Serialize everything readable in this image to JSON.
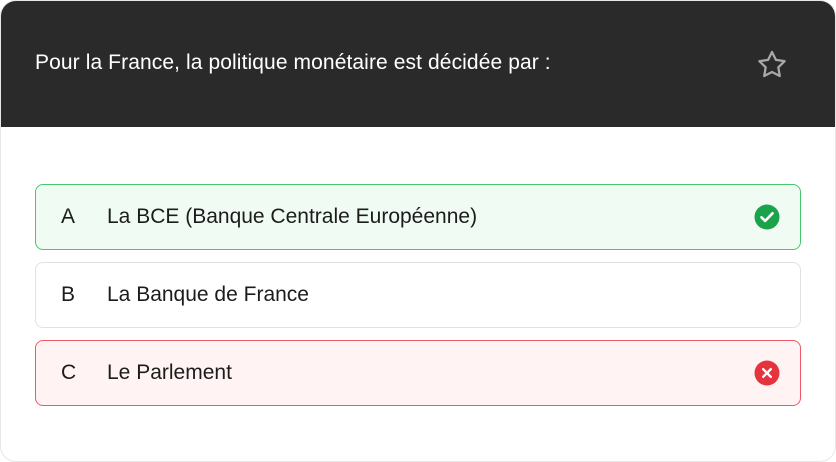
{
  "question": {
    "text": "Pour la France, la politique monétaire est décidée par :",
    "favorite_icon": "star-outline-icon"
  },
  "colors": {
    "header_bg": "#2a2a2a",
    "correct_border": "#47c76d",
    "correct_bg": "#f0fcf3",
    "correct_icon": "#1aa34a",
    "wrong_border": "#ee5a63",
    "wrong_bg": "#fff3f3",
    "wrong_icon": "#e5343d"
  },
  "options": [
    {
      "letter": "A",
      "label": "La BCE (Banque Centrale Européenne)",
      "state": "correct",
      "icon": "check-circle-icon"
    },
    {
      "letter": "B",
      "label": "La Banque de France",
      "state": "neutral",
      "icon": ""
    },
    {
      "letter": "C",
      "label": "Le Parlement",
      "state": "wrong",
      "icon": "x-circle-icon"
    }
  ]
}
